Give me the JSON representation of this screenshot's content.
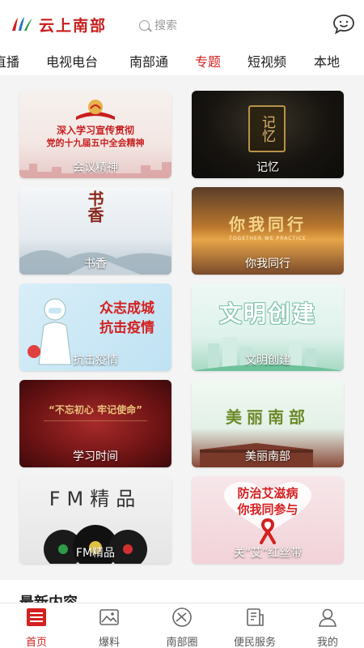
{
  "header": {
    "logo_text": "云上南部",
    "search_placeholder": "搜索",
    "chat_icon": "chat-bubble-icon"
  },
  "tabs": [
    {
      "label": "直播",
      "active": false
    },
    {
      "label": "电视电台",
      "active": false
    },
    {
      "label": "南部通",
      "active": false
    },
    {
      "label": "专题",
      "active": true
    },
    {
      "label": "短视频",
      "active": false
    },
    {
      "label": "本地",
      "active": false
    }
  ],
  "cards": [
    {
      "label": "会议精神",
      "image_text": [
        "深入学习宣传贯彻",
        "党的十九届五中全会精神"
      ]
    },
    {
      "label": "记忆",
      "image_text": [
        "记忆"
      ]
    },
    {
      "label": "书香",
      "image_text": [
        "书香"
      ]
    },
    {
      "label": "你我同行",
      "image_text": [
        "你我同行",
        "TOGETHER WE PRACTICE"
      ]
    },
    {
      "label": "抗击疫情",
      "image_text": [
        "众志成城",
        "抗击疫情"
      ]
    },
    {
      "label": "文明创建",
      "image_text": [
        "文明创建"
      ]
    },
    {
      "label": "学习时间",
      "image_text": [
        "“不忘初心 牢记使命”"
      ]
    },
    {
      "label": "美丽南部",
      "image_text": [
        "美丽南部"
      ]
    },
    {
      "label": "FM精品",
      "image_text": [
        "FM精品"
      ]
    },
    {
      "label": "关“艾”红丝带",
      "image_text": [
        "防治艾滋病",
        "你我同参与"
      ]
    }
  ],
  "section": {
    "title": "最新内容"
  },
  "bottom_nav": [
    {
      "label": "首页",
      "icon": "home-icon",
      "active": true
    },
    {
      "label": "爆料",
      "icon": "image-icon",
      "active": false
    },
    {
      "label": "南部圈",
      "icon": "compass-icon",
      "active": false
    },
    {
      "label": "便民服务",
      "icon": "service-icon",
      "active": false
    },
    {
      "label": "我的",
      "icon": "user-icon",
      "active": false
    }
  ],
  "colors": {
    "accent": "#d42020"
  }
}
